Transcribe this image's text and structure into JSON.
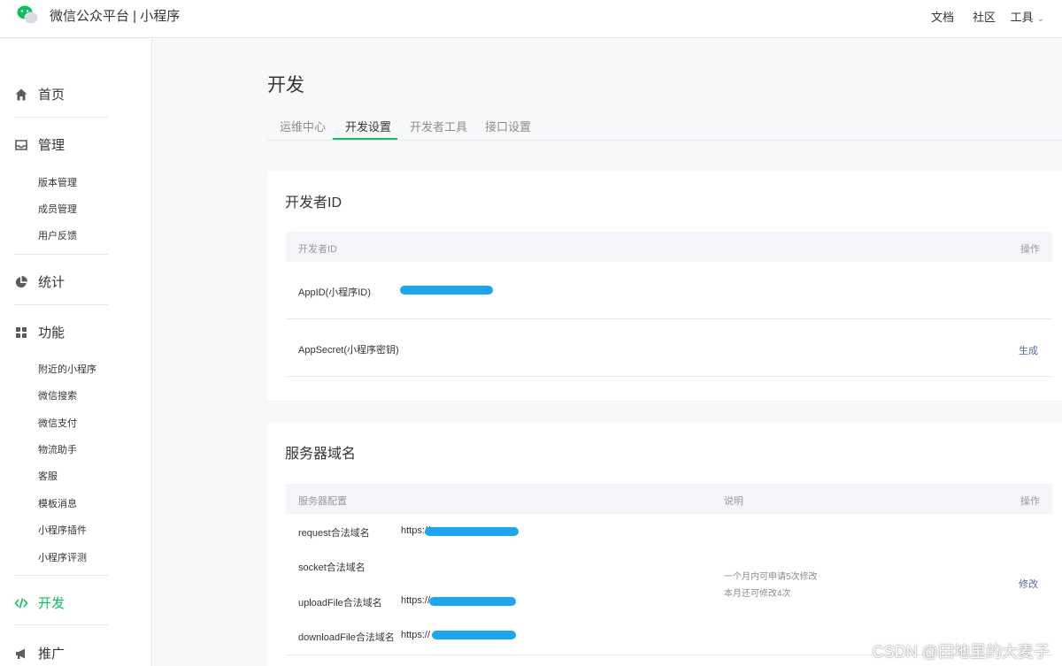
{
  "header": {
    "brand": "微信公众平台 | 小程序",
    "nav": [
      "文档",
      "社区",
      "工具"
    ]
  },
  "sidebar": {
    "sections": [
      {
        "label": "首页",
        "icon": "home-icon"
      },
      {
        "label": "管理",
        "icon": "inbox-icon",
        "items": [
          "版本管理",
          "成员管理",
          "用户反馈"
        ]
      },
      {
        "label": "统计",
        "icon": "pie-chart-icon"
      },
      {
        "label": "功能",
        "icon": "grid-icon",
        "items": [
          "附近的小程序",
          "微信搜索",
          "微信支付",
          "物流助手",
          "客服",
          "模板消息",
          "小程序插件",
          "小程序评测"
        ]
      },
      {
        "label": "开发",
        "icon": "code-icon",
        "active": true
      },
      {
        "label": "推广",
        "icon": "megaphone-icon"
      }
    ]
  },
  "main": {
    "title": "开发",
    "tabs": [
      "运维中心",
      "开发设置",
      "开发者工具",
      "接口设置"
    ],
    "active_tab": "开发设置",
    "developer_id": {
      "title": "开发者ID",
      "columns": [
        "开发者ID",
        "操作"
      ],
      "rows": [
        {
          "label": "AppID(小程序ID)",
          "action": ""
        },
        {
          "label": "AppSecret(小程序密钥)",
          "action": "生成"
        }
      ]
    },
    "server_domain": {
      "title": "服务器域名",
      "columns": [
        "服务器配置",
        "说明",
        "操作"
      ],
      "rows": [
        {
          "label": "request合法域名",
          "value": "https://"
        },
        {
          "label": "socket合法域名",
          "value": ""
        },
        {
          "label": "uploadFile合法域名",
          "value": "https://"
        },
        {
          "label": "downloadFile合法域名",
          "value": "https://"
        }
      ],
      "note": [
        "一个月内可申请5次修改",
        "本月还可修改4次"
      ],
      "action": "修改"
    }
  },
  "watermark": "CSDN @田地里的大麦子",
  "colors": {
    "accent": "#07c160",
    "link": "#576b95",
    "redaction": "#1aa6f0"
  }
}
